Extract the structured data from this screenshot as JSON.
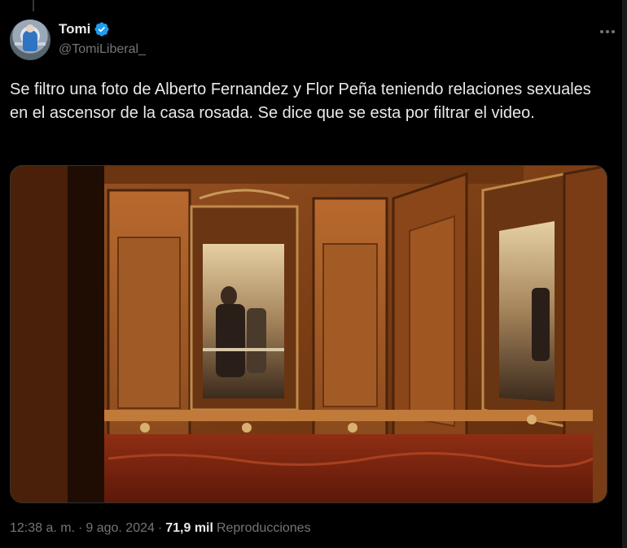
{
  "author": {
    "display_name": "Tomi",
    "handle": "@TomiLiberal_",
    "verified": true,
    "verified_color": "#1d9bf0"
  },
  "tweet": {
    "text": "Se filtro una foto de Alberto Fernandez y Flor Peña teniendo relaciones sexuales en el ascensor de la casa rosada. Se dice que se esta por filtrar el video."
  },
  "meta": {
    "time": "12:38 a. m.",
    "separator1": "·",
    "date": "9 ago. 2024",
    "separator2": "·",
    "views_count": "71,9 mil",
    "views_label": "Reproducciones"
  },
  "icons": {
    "verified": "verified-badge-icon",
    "more": "more-options-icon"
  },
  "colors": {
    "background": "#000000",
    "text_primary": "#e7e9ea",
    "text_secondary": "#71767b",
    "wood": "#8a4a1c"
  }
}
